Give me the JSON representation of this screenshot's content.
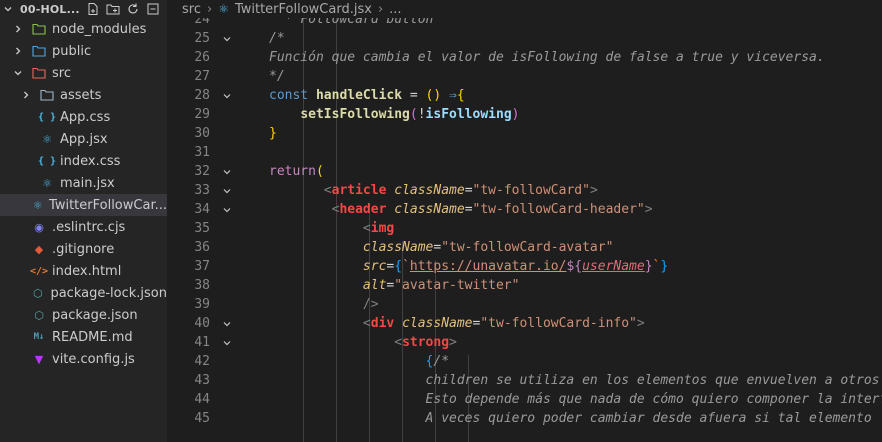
{
  "explorer": {
    "project_title": "00-HOL...",
    "items": [
      {
        "label": "node_modules",
        "icon": "folder-node-icon",
        "chevron": "right",
        "depth": 1,
        "selected": false
      },
      {
        "label": "public",
        "icon": "folder-public-icon",
        "chevron": "right",
        "depth": 1,
        "selected": false
      },
      {
        "label": "src",
        "icon": "folder-src-icon",
        "chevron": "down",
        "depth": 1,
        "selected": false
      },
      {
        "label": "assets",
        "icon": "folder-assets-icon",
        "chevron": "right",
        "depth": 2,
        "selected": false
      },
      {
        "label": "App.css",
        "icon": "css-file-icon",
        "chevron": "",
        "depth": 2,
        "selected": false
      },
      {
        "label": "App.jsx",
        "icon": "react-file-icon",
        "chevron": "",
        "depth": 2,
        "selected": false
      },
      {
        "label": "index.css",
        "icon": "css-file-icon",
        "chevron": "",
        "depth": 2,
        "selected": false
      },
      {
        "label": "main.jsx",
        "icon": "react-file-icon",
        "chevron": "",
        "depth": 2,
        "selected": false
      },
      {
        "label": "TwitterFollowCar...",
        "icon": "react-file-icon",
        "chevron": "",
        "depth": 2,
        "selected": true
      },
      {
        "label": ".eslintrc.cjs",
        "icon": "eslint-file-icon",
        "chevron": "",
        "depth": 1,
        "selected": false
      },
      {
        "label": ".gitignore",
        "icon": "git-file-icon",
        "chevron": "",
        "depth": 1,
        "selected": false
      },
      {
        "label": "index.html",
        "icon": "html-file-icon",
        "chevron": "",
        "depth": 1,
        "selected": false
      },
      {
        "label": "package-lock.json",
        "icon": "json-file-icon",
        "chevron": "",
        "depth": 1,
        "selected": false
      },
      {
        "label": "package.json",
        "icon": "json-file-icon",
        "chevron": "",
        "depth": 1,
        "selected": false
      },
      {
        "label": "README.md",
        "icon": "markdown-file-icon",
        "chevron": "",
        "depth": 1,
        "selected": false
      },
      {
        "label": "vite.config.js",
        "icon": "vite-file-icon",
        "chevron": "",
        "depth": 1,
        "selected": false
      }
    ]
  },
  "breadcrumb": {
    "folder": "src",
    "file": "TwitterFollowCard.jsx",
    "trail": "..."
  },
  "editor": {
    "lines": [
      {
        "n": "24",
        "fold": false,
        "tokens": [
          [
            "cmg",
            "  * "
          ],
          [
            "cmg",
            "FollowCard button"
          ]
        ]
      },
      {
        "n": "25",
        "fold": true,
        "tokens": [
          [
            "cmg",
            "/*"
          ]
        ]
      },
      {
        "n": "26",
        "fold": false,
        "tokens": [
          [
            "cmg",
            "Función que cambia el valor de isFollowing de false a true y viceversa."
          ]
        ]
      },
      {
        "n": "27",
        "fold": false,
        "tokens": [
          [
            "cmg",
            "*/"
          ]
        ]
      },
      {
        "n": "28",
        "fold": true,
        "tokens": [
          [
            "kwb",
            "const "
          ],
          [
            "fn",
            "handleClick"
          ],
          [
            "op",
            " = "
          ],
          [
            "p1",
            "()"
          ],
          [
            "op",
            " "
          ],
          [
            "kwb",
            "⇒"
          ],
          [
            "p1",
            "{"
          ]
        ]
      },
      {
        "n": "29",
        "fold": false,
        "tokens": [
          [
            "op",
            "    "
          ],
          [
            "fn",
            "setIsFollowing"
          ],
          [
            "p2",
            "("
          ],
          [
            "op",
            "!"
          ],
          [
            "var",
            "isFollowing"
          ],
          [
            "p2",
            ")"
          ]
        ]
      },
      {
        "n": "30",
        "fold": false,
        "tokens": [
          [
            "p1",
            "}"
          ]
        ]
      },
      {
        "n": "31",
        "fold": false,
        "tokens": []
      },
      {
        "n": "32",
        "fold": true,
        "tokens": [
          [
            "kw",
            "return"
          ],
          [
            "p1",
            "("
          ]
        ]
      },
      {
        "n": "33",
        "fold": true,
        "tokens": [
          [
            "op",
            "       "
          ],
          [
            "tagb",
            "<"
          ],
          [
            "tag",
            "article"
          ],
          [
            "op",
            " "
          ],
          [
            "attr",
            "className"
          ],
          [
            "op",
            "="
          ],
          [
            "str",
            "\"tw-followCard\""
          ],
          [
            "tagb",
            ">"
          ]
        ]
      },
      {
        "n": "34",
        "fold": true,
        "tokens": [
          [
            "op",
            "        "
          ],
          [
            "tagb",
            "<"
          ],
          [
            "tag",
            "header"
          ],
          [
            "op",
            " "
          ],
          [
            "attr",
            "className"
          ],
          [
            "op",
            "="
          ],
          [
            "str",
            "\"tw-followCard-header\""
          ],
          [
            "tagb",
            ">"
          ]
        ]
      },
      {
        "n": "35",
        "fold": false,
        "tokens": [
          [
            "op",
            "            "
          ],
          [
            "tagb",
            "<"
          ],
          [
            "tag",
            "img"
          ]
        ]
      },
      {
        "n": "36",
        "fold": false,
        "tokens": [
          [
            "op",
            "            "
          ],
          [
            "attr",
            "className"
          ],
          [
            "op",
            "="
          ],
          [
            "str",
            "\"tw-followCard-avatar\""
          ]
        ]
      },
      {
        "n": "37",
        "fold": false,
        "tokens": [
          [
            "op",
            "            "
          ],
          [
            "attr",
            "src"
          ],
          [
            "op",
            "="
          ],
          [
            "p3",
            "{"
          ],
          [
            "tpl",
            "`"
          ],
          [
            "link",
            "https://unavatar.io/"
          ],
          [
            "interp",
            "${"
          ],
          [
            "tvar",
            "userName"
          ],
          [
            "interp",
            "}"
          ],
          [
            "tpl",
            "`"
          ],
          [
            "p3",
            "}"
          ]
        ]
      },
      {
        "n": "38",
        "fold": false,
        "tokens": [
          [
            "op",
            "            "
          ],
          [
            "attr",
            "alt"
          ],
          [
            "op",
            "="
          ],
          [
            "str",
            "\"avatar-twitter\""
          ]
        ]
      },
      {
        "n": "39",
        "fold": false,
        "tokens": [
          [
            "op",
            "            "
          ],
          [
            "tagb",
            "/>"
          ]
        ]
      },
      {
        "n": "40",
        "fold": true,
        "tokens": [
          [
            "op",
            "            "
          ],
          [
            "tagb",
            "<"
          ],
          [
            "tag",
            "div"
          ],
          [
            "op",
            " "
          ],
          [
            "attr",
            "className"
          ],
          [
            "op",
            "="
          ],
          [
            "str",
            "\"tw-followCard-info\""
          ],
          [
            "tagb",
            ">"
          ]
        ]
      },
      {
        "n": "41",
        "fold": true,
        "tokens": [
          [
            "op",
            "                "
          ],
          [
            "tagb",
            "<"
          ],
          [
            "tag",
            "strong"
          ],
          [
            "tagb",
            ">"
          ]
        ]
      },
      {
        "n": "42",
        "fold": false,
        "tokens": [
          [
            "op",
            "                    "
          ],
          [
            "p3",
            "{"
          ],
          [
            "cmg",
            "/*"
          ]
        ]
      },
      {
        "n": "43",
        "fold": false,
        "tokens": [
          [
            "op",
            "                    "
          ],
          [
            "cmg",
            "children se utiliza en los elementos que envuelven a otros"
          ]
        ]
      },
      {
        "n": "44",
        "fold": false,
        "tokens": [
          [
            "op",
            "                    "
          ],
          [
            "cmg",
            "Esto depende más que nada de cómo quiero componer la interfaz"
          ]
        ]
      },
      {
        "n": "45",
        "fold": false,
        "tokens": [
          [
            "op",
            "                    "
          ],
          [
            "cmg",
            "A veces quiero poder cambiar desde afuera si tal elemento"
          ]
        ]
      }
    ]
  }
}
